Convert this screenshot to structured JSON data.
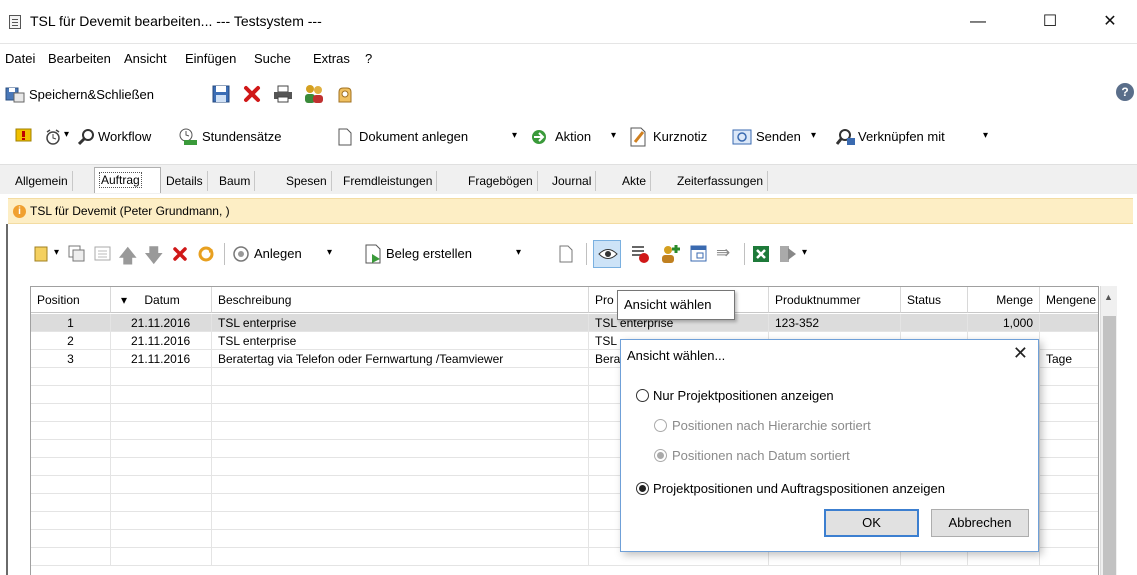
{
  "window": {
    "title": "TSL für Devemit bearbeiten... --- Testsystem ---",
    "minimize": "—",
    "maximize": "☐",
    "close": "✕"
  },
  "menu": [
    "Datei",
    "Bearbeiten",
    "Ansicht",
    "Einfügen",
    "Suche",
    "Extras",
    "?"
  ],
  "toolbar1": {
    "save_close_label": "Speichern&Schließen",
    "help": "?"
  },
  "toolbar2": {
    "workflow_label": "Workflow",
    "rates_label": "Stundensätze",
    "create_doc_label": "Dokument anlegen",
    "action_label": "Aktion",
    "note_label": "Kurznotiz",
    "send_label": "Senden",
    "link_label": "Verknüpfen mit"
  },
  "tabs": [
    "Allgemein",
    "Auftrag",
    "Details",
    "Baum",
    "Spesen",
    "Fremdleistungen",
    "Fragebögen",
    "Journal",
    "Akte",
    "Zeiterfassungen"
  ],
  "active_tab": "Auftrag",
  "info": {
    "icon": "i",
    "text": "TSL für Devemit (Peter Grundmann, )"
  },
  "toolbar3": {
    "create_label": "Anlegen",
    "voucher_label": "Beleg erstellen"
  },
  "grid": {
    "columns": [
      "Position",
      "Datum",
      "Beschreibung",
      "Pro",
      "Produktnummer",
      "Status",
      "Menge",
      "Mengene"
    ],
    "sort_indicator": "▾",
    "rows": [
      {
        "position": "1",
        "datum": "21.11.2016",
        "beschreibung": "TSL enterprise",
        "produkt": "TSL enterprise",
        "produktnummer": "123-352",
        "status": "",
        "menge": "1,000",
        "einheit": ""
      },
      {
        "position": "2",
        "datum": "21.11.2016",
        "beschreibung": "TSL enterprise",
        "produkt": "TSL",
        "produktnummer": "",
        "status": "",
        "menge": "",
        "einheit": ""
      },
      {
        "position": "3",
        "datum": "21.11.2016",
        "beschreibung": "Beratertag via Telefon oder Fernwartung /Teamviewer",
        "produkt": "Bera",
        "produktnummer": "",
        "status": "",
        "menge": "",
        "einheit": "Tage"
      }
    ]
  },
  "tooltip": "Ansicht wählen",
  "dialog": {
    "title": "Ansicht wählen...",
    "close": "✕",
    "options": [
      {
        "label": "Nur Projektpositionen anzeigen",
        "checked": false,
        "disabled": false
      },
      {
        "label": "Positionen nach Hierarchie sortiert",
        "checked": false,
        "disabled": true
      },
      {
        "label": "Positionen nach Datum sortiert",
        "checked": true,
        "disabled": true
      },
      {
        "label": "Projektpositionen und Auftragspositionen anzeigen",
        "checked": true,
        "disabled": false
      }
    ],
    "ok_label": "OK",
    "cancel_label": "Abbrechen"
  },
  "colors": {
    "info_bar": "#fdeec5",
    "selected_row": "#dcdcdc",
    "dialog_border": "#6fa0d8",
    "delete_red": "#d01818"
  }
}
